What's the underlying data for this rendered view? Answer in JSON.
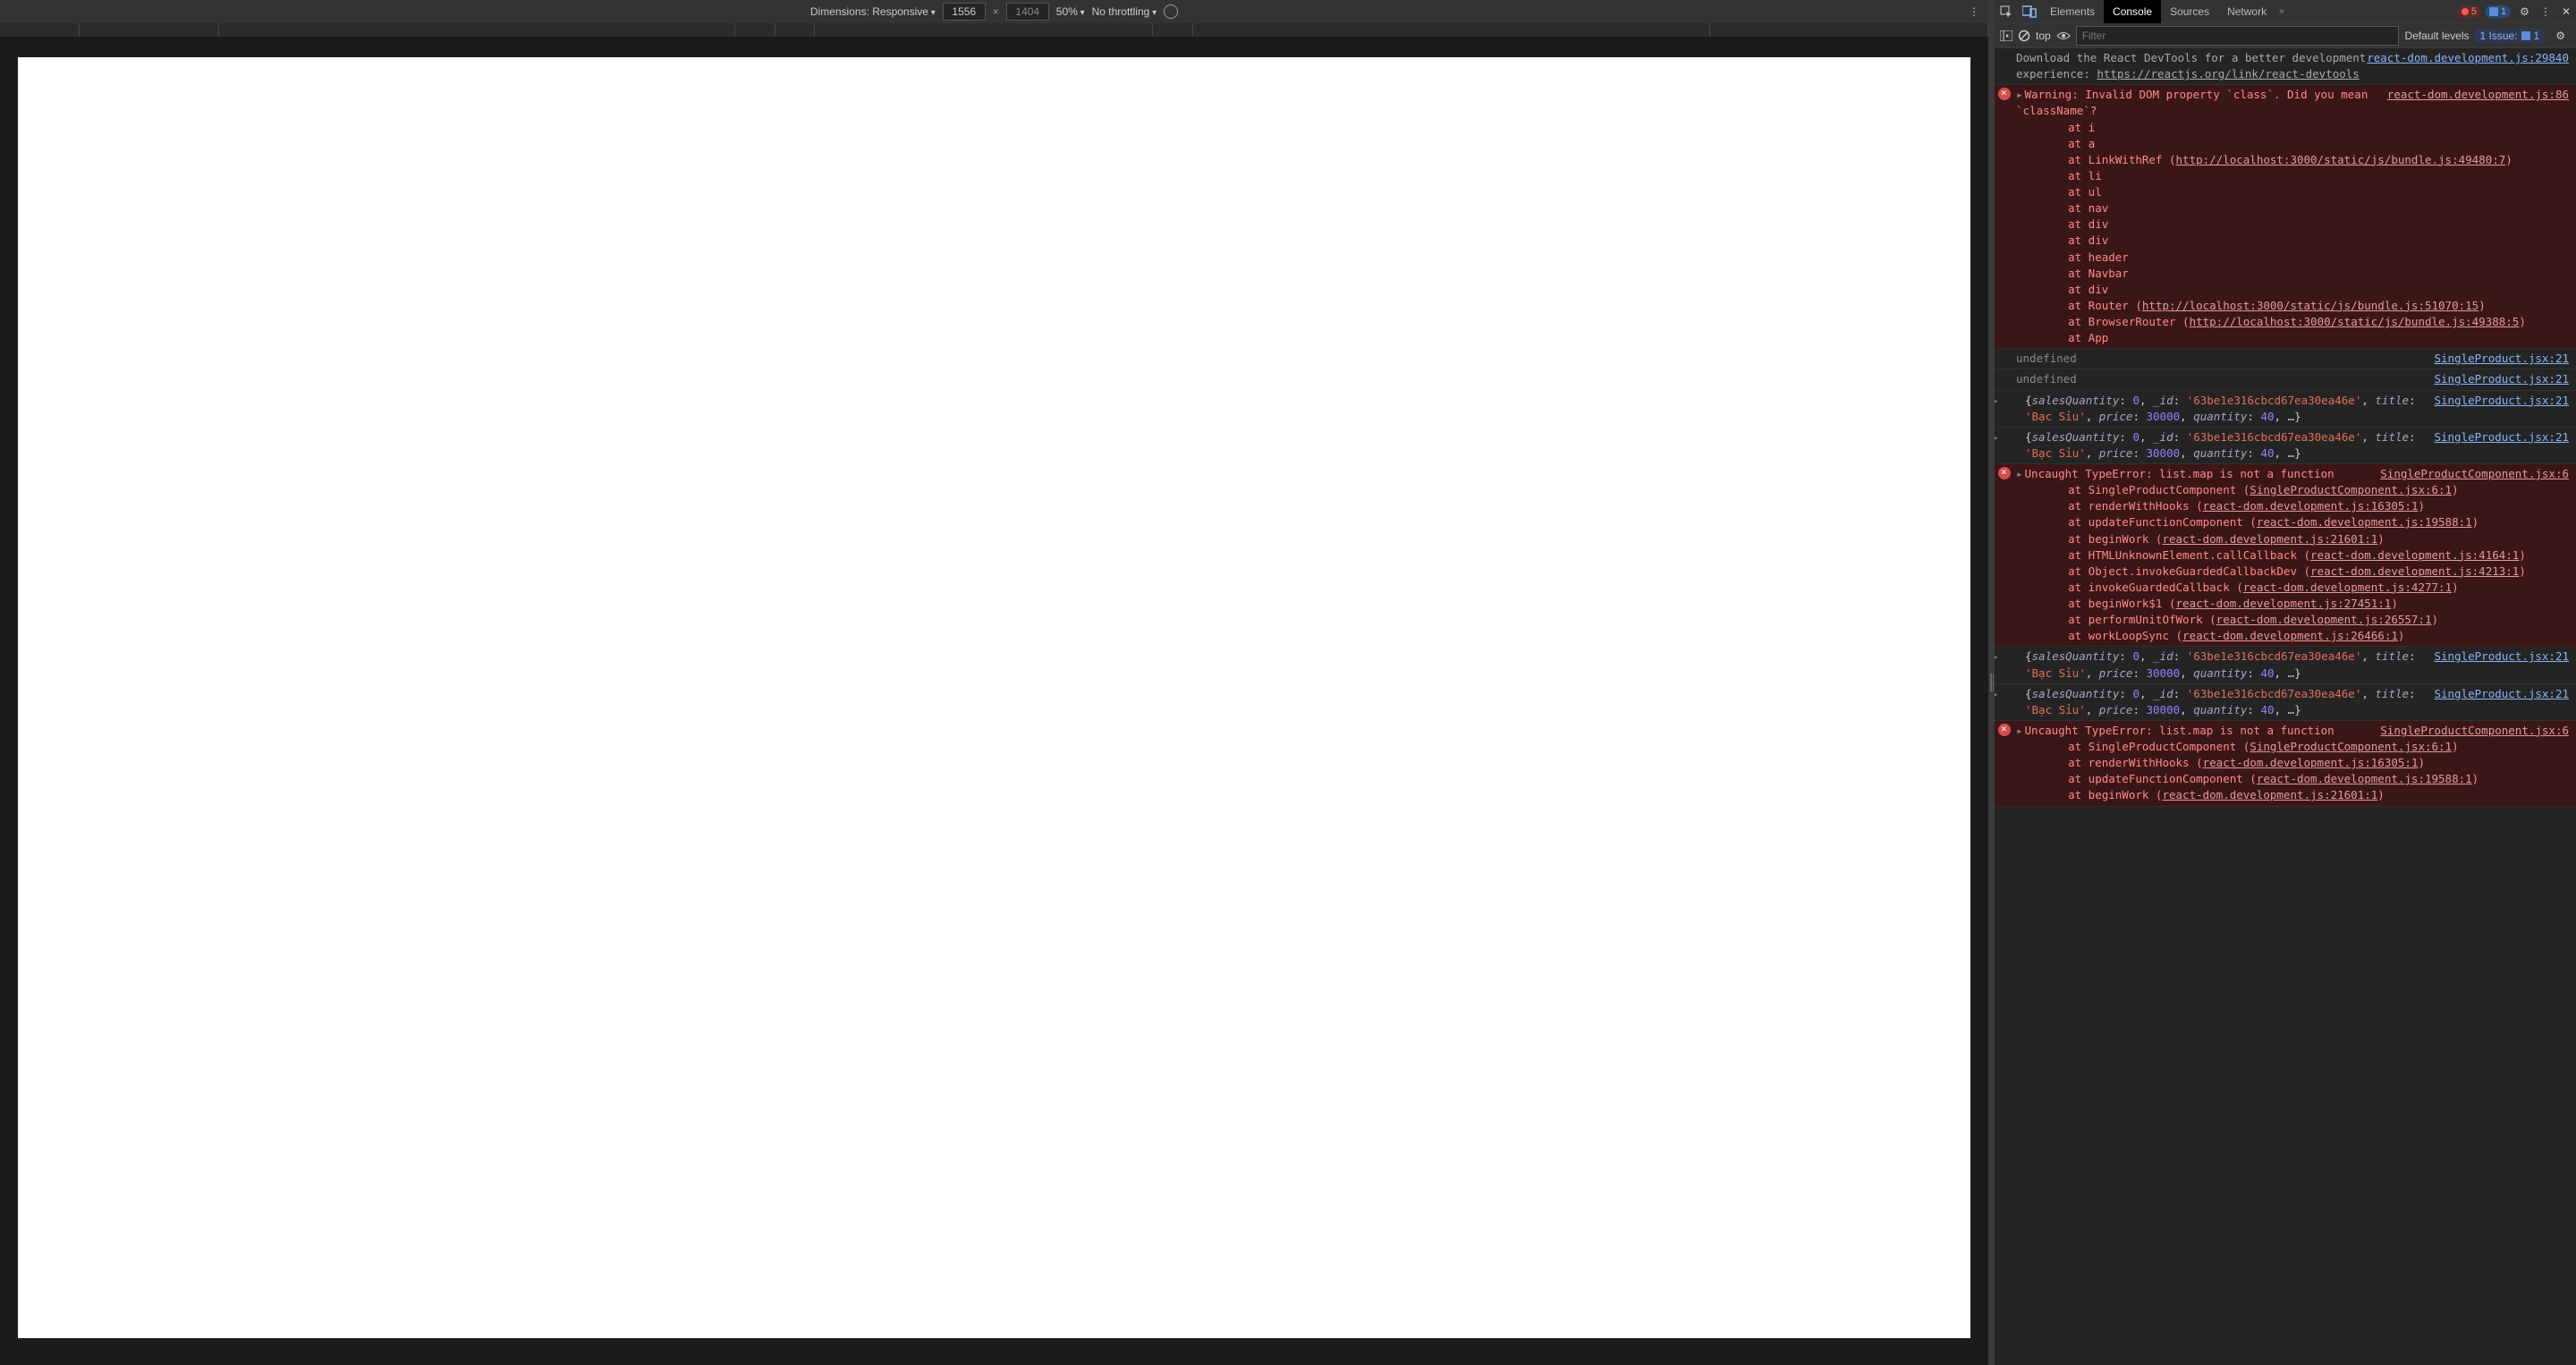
{
  "deviceToolbar": {
    "dimensionsLabel": "Dimensions: Responsive",
    "width": "1556",
    "height": "1404",
    "zoom": "50%",
    "throttling": "No throttling"
  },
  "tabs": {
    "elements": "Elements",
    "console": "Console",
    "sources": "Sources",
    "network": "Network"
  },
  "badges": {
    "errors": "5",
    "info": "1"
  },
  "controls": {
    "context": "top",
    "filterPlaceholder": "Filter",
    "levels": "Default levels",
    "issuesLabel": "1 Issue:",
    "issuesCount": "1"
  },
  "links": {
    "reactDom29840": "react-dom.development.js:29840",
    "reactDom86": "react-dom.development.js:86",
    "singleProduct21": "SingleProduct.jsx:21",
    "singleProductComp6": "SingleProductComponent.jsx:6",
    "devtoolsText": "Download the React DevTools for a better development experience: ",
    "devtoolsUrl": "https://reactjs.org/link/react-devtools",
    "bundle49480": "http://localhost:3000/static/js/bundle.js:49480:7",
    "bundle51070": "http://localhost:3000/static/js/bundle.js:51070:15",
    "bundle49388": "http://localhost:3000/static/js/bundle.js:49388:5",
    "spc6_1": "SingleProductComponent.jsx:6:1",
    "rdd16305": "react-dom.development.js:16305:1",
    "rdd19588": "react-dom.development.js:19588:1",
    "rdd21601": "react-dom.development.js:21601:1",
    "rdd4164": "react-dom.development.js:4164:1",
    "rdd4213": "react-dom.development.js:4213:1",
    "rdd4277": "react-dom.development.js:4277:1",
    "rdd27451": "react-dom.development.js:27451:1",
    "rdd26557": "react-dom.development.js:26557:1",
    "rdd26466": "react-dom.development.js:26466:1"
  },
  "warningText": "Warning: Invalid DOM property `class`. Did you mean `className`?",
  "stack1": [
    "    at i",
    "    at a",
    "    at LinkWithRef (",
    "    at li",
    "    at ul",
    "    at nav",
    "    at div",
    "    at div",
    "    at header",
    "    at Navbar",
    "    at div",
    "    at Router (",
    "    at BrowserRouter (",
    "    at App"
  ],
  "undefinedText": "undefined",
  "objectSample": {
    "salesQuantityKey": "salesQuantity",
    "salesQuantityVal": "0",
    "idKey": "_id",
    "idVal": "'63be1e316cbcd67ea30ea46e'",
    "titleKey": "title",
    "titleVal": "'Bạc Sỉu'",
    "priceKey": "price",
    "priceVal": "30000",
    "quantityKey": "quantity",
    "quantityVal": "40",
    "rest": ", …}"
  },
  "typeErrorText": "Uncaught TypeError: list.map is not a function",
  "stack2": [
    {
      "pre": "    at SingleProductComponent (",
      "link": "spc6_1",
      "post": ")"
    },
    {
      "pre": "    at renderWithHooks (",
      "link": "rdd16305",
      "post": ")"
    },
    {
      "pre": "    at updateFunctionComponent (",
      "link": "rdd19588",
      "post": ")"
    },
    {
      "pre": "    at beginWork (",
      "link": "rdd21601",
      "post": ")"
    },
    {
      "pre": "    at HTMLUnknownElement.callCallback (",
      "link": "rdd4164",
      "post": ")"
    },
    {
      "pre": "    at Object.invokeGuardedCallbackDev (",
      "link": "rdd4213",
      "post": ")"
    },
    {
      "pre": "    at invokeGuardedCallback (",
      "link": "rdd4277",
      "post": ")"
    },
    {
      "pre": "    at beginWork$1 (",
      "link": "rdd27451",
      "post": ")"
    },
    {
      "pre": "    at performUnitOfWork (",
      "link": "rdd26557",
      "post": ")"
    },
    {
      "pre": "    at workLoopSync (",
      "link": "rdd26466",
      "post": ")"
    }
  ],
  "stack3": [
    {
      "pre": "    at SingleProductComponent (",
      "link": "spc6_1",
      "post": ")"
    },
    {
      "pre": "    at renderWithHooks (",
      "link": "rdd16305",
      "post": ")"
    },
    {
      "pre": "    at updateFunctionComponent (",
      "link": "rdd19588",
      "post": ")"
    },
    {
      "pre": "    at beginWork (",
      "link": "rdd21601",
      "post": ")"
    }
  ]
}
